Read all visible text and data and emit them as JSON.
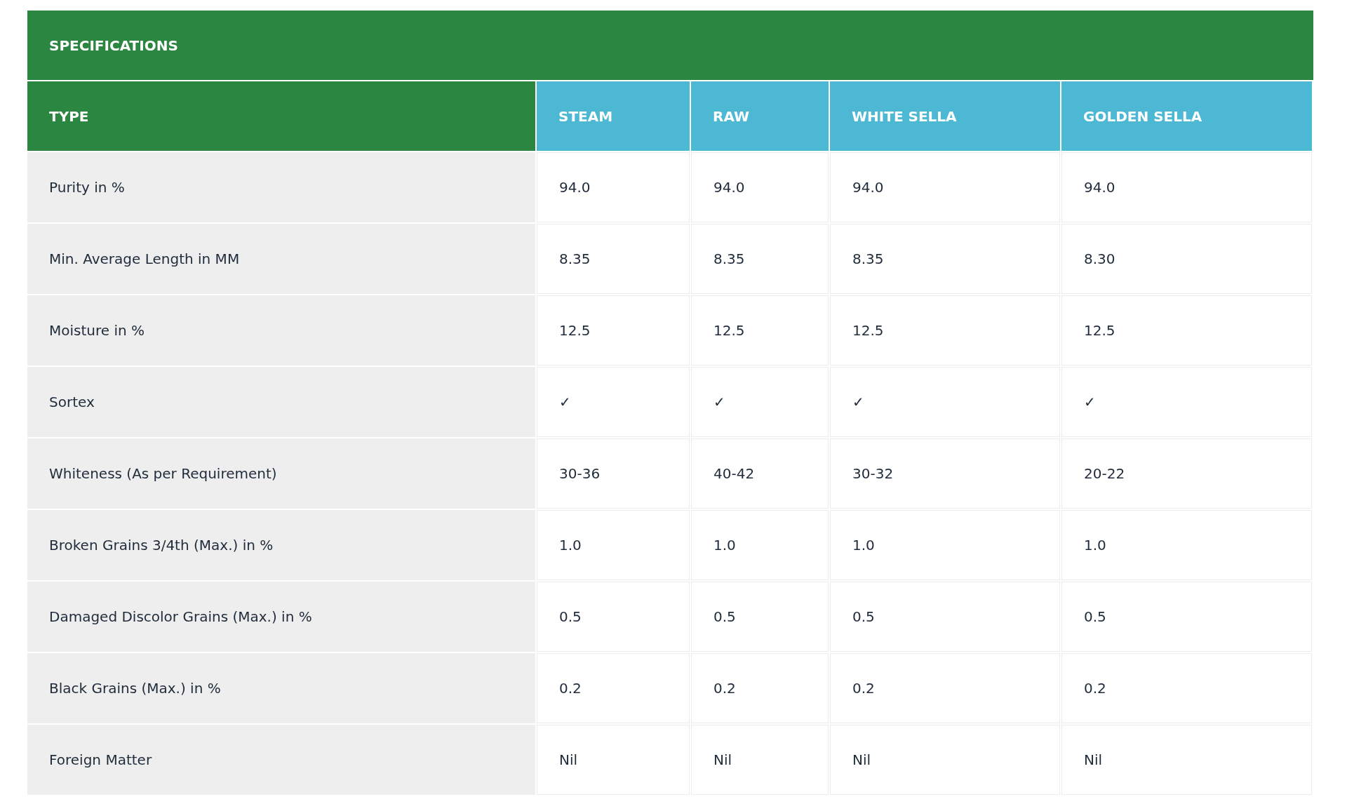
{
  "title": "SPECIFICATIONS",
  "columns": [
    {
      "label": "TYPE",
      "kind": "type"
    },
    {
      "label": "STEAM",
      "kind": "variety"
    },
    {
      "label": "RAW",
      "kind": "variety"
    },
    {
      "label": "WHITE SELLA",
      "kind": "variety"
    },
    {
      "label": "GOLDEN SELLA",
      "kind": "variety"
    }
  ],
  "rows": [
    {
      "label": "Purity in %",
      "values": [
        "94.0",
        "94.0",
        "94.0",
        "94.0"
      ]
    },
    {
      "label": "Min. Average Length in MM",
      "values": [
        "8.35",
        "8.35",
        "8.35",
        "8.30"
      ]
    },
    {
      "label": "Moisture in %",
      "values": [
        "12.5",
        "12.5",
        "12.5",
        "12.5"
      ]
    },
    {
      "label": "Sortex",
      "values": [
        "✓",
        "✓",
        "✓",
        "✓"
      ]
    },
    {
      "label": "Whiteness (As per Requirement)",
      "values": [
        "30-36",
        "40-42",
        "30-32",
        "20-22"
      ]
    },
    {
      "label": "Broken Grains 3/4th (Max.) in %",
      "values": [
        "1.0",
        "1.0",
        "1.0",
        "1.0"
      ]
    },
    {
      "label": "Damaged Discolor Grains (Max.) in %",
      "values": [
        "0.5",
        "0.5",
        "0.5",
        "0.5"
      ]
    },
    {
      "label": "Black Grains (Max.) in %",
      "values": [
        "0.2",
        "0.2",
        "0.2",
        "0.2"
      ]
    },
    {
      "label": "Foreign Matter",
      "values": [
        "Nil",
        "Nil",
        "Nil",
        "Nil"
      ]
    }
  ]
}
